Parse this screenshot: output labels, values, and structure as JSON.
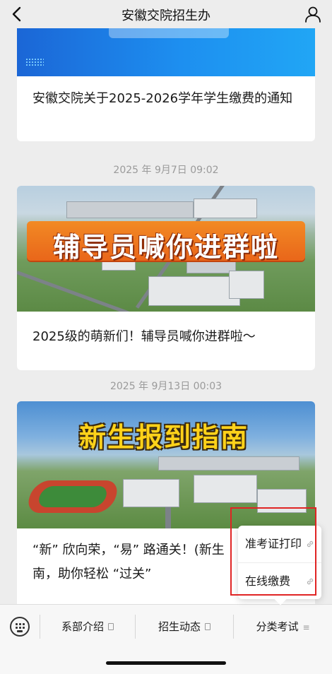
{
  "header": {
    "title": "安徽交院招生办",
    "back_icon": "chevron-left-icon",
    "profile_icon": "user-icon"
  },
  "feed": {
    "card1": {
      "title": "安徽交院关于2025-2026学年学生缴费的通知"
    },
    "timestamp2": "2025 年 9月7日 09:02",
    "card2": {
      "banner_text": "辅导员喊你进群啦",
      "title": "2025级的萌新们！辅导员喊你进群啦～"
    },
    "timestamp3": "2025 年 9月13日 00:03",
    "card3": {
      "banner_text": "新生报到指南",
      "title_line1": "“新” 欣向荣，“易” 路通关！(新生",
      "title_line2": "南，助你轻松 “过关”"
    }
  },
  "popup_menu": {
    "items": [
      {
        "label": "准考证打印",
        "icon": "link-icon"
      },
      {
        "label": "在线缴费",
        "icon": "link-icon"
      }
    ]
  },
  "bottom_menu": {
    "keyboard_icon": "keyboard-icon",
    "tabs": [
      {
        "label": "系部介绍",
        "icon": "page-icon"
      },
      {
        "label": "招生动态",
        "icon": "page-icon"
      },
      {
        "label": "分类考试",
        "icon": "menu-icon",
        "icon_glyph": "≡"
      }
    ]
  },
  "colors": {
    "background": "#ededed",
    "highlight_border": "#e02424",
    "banner_orange": "#f28a24",
    "banner_yellow": "#ffd21a"
  }
}
